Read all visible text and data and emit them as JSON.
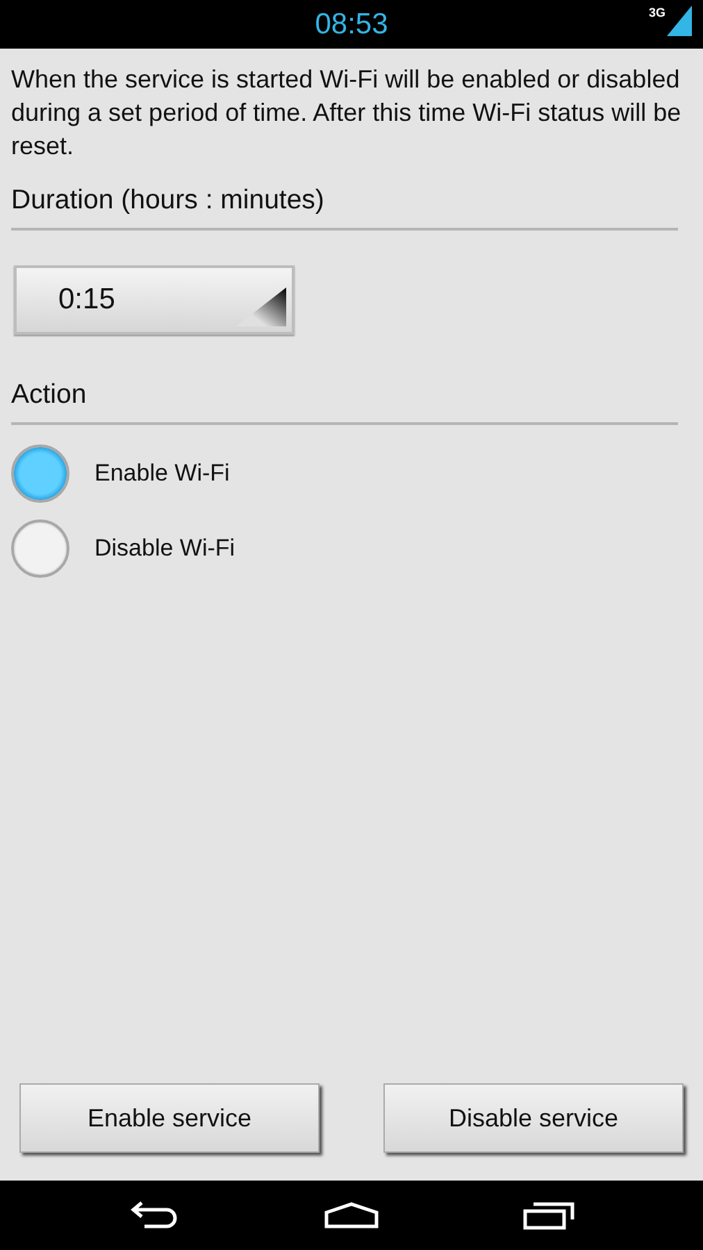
{
  "status_bar": {
    "time": "08:53",
    "network": "3G"
  },
  "description": "When the service is started Wi-Fi will be enabled or disabled during a set period of time. After this time Wi-Fi status will be reset.",
  "duration": {
    "label": "Duration (hours : minutes)",
    "value": "0:15"
  },
  "action": {
    "label": "Action",
    "options": [
      {
        "label": "Enable Wi-Fi",
        "selected": true
      },
      {
        "label": "Disable Wi-Fi",
        "selected": false
      }
    ]
  },
  "buttons": [
    "Enable service",
    "Disable service"
  ]
}
